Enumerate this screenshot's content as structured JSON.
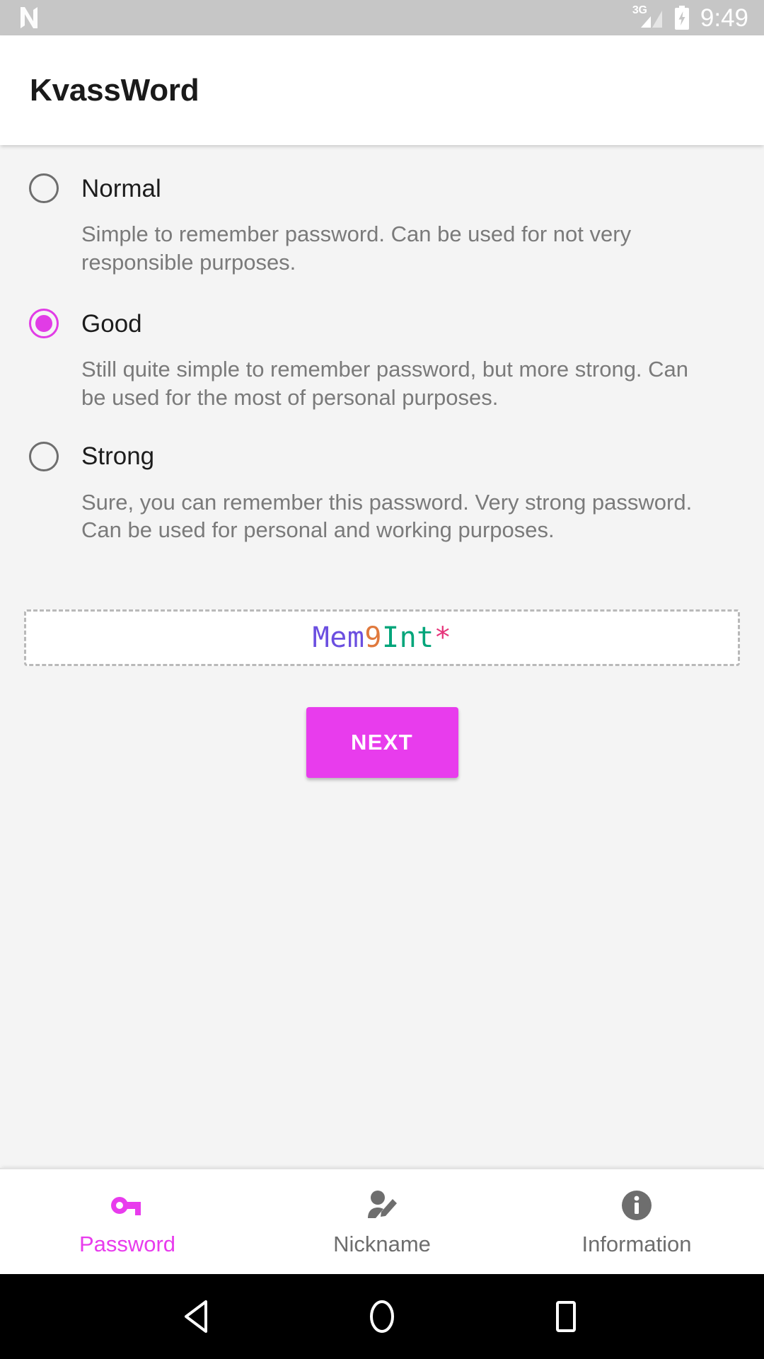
{
  "status_bar": {
    "notification_icon": "android-n-logo-icon",
    "network_type": "3G",
    "signal_icon": "signal-bars-icon",
    "battery_icon": "battery-charging-icon",
    "time": "9:49",
    "background_color": "#C6C6C6",
    "foreground_color": "#FFFFFF"
  },
  "app_bar": {
    "title": "KvassWord",
    "background_color": "#FFFFFF",
    "title_color": "#1A1A1A"
  },
  "theme": {
    "accent_color": "#E83CED",
    "radio_selected_color": "#E13CE6",
    "content_background": "#F4F4F4",
    "secondary_text_color": "#7A7A7A"
  },
  "main": {
    "options": [
      {
        "label": "Normal",
        "description": "Simple to remember password. Can be used for not very responsible purposes.",
        "selected": false
      },
      {
        "label": "Good",
        "description": "Still quite simple to remember password, but more strong. Can be used for the most of personal purposes.",
        "selected": true
      },
      {
        "label": "Strong",
        "description": "Sure, you can remember this password. Very strong password. Can be used for personal and working purposes.",
        "selected": false
      }
    ],
    "password_preview": {
      "value": "Mem9Int*",
      "segments": [
        {
          "text": "Mem",
          "color": "#6B4FE0"
        },
        {
          "text": "9",
          "color": "#E0793D"
        },
        {
          "text": "Int",
          "color": "#00A57A"
        },
        {
          "text": "*",
          "color": "#E6347A"
        }
      ],
      "border_style": "dashed",
      "border_color": "#B9B9B9",
      "background_color": "#FFFFFF"
    },
    "next_button": {
      "label": "NEXT",
      "background_color": "#E83CED",
      "text_color": "#FFFFFF"
    }
  },
  "tab_bar": {
    "tabs": [
      {
        "label": "Password",
        "icon": "key-icon",
        "active": true
      },
      {
        "label": "Nickname",
        "icon": "person-edit-icon",
        "active": false
      },
      {
        "label": "Information",
        "icon": "info-circle-icon",
        "active": false
      }
    ]
  },
  "nav_bar": {
    "buttons": [
      {
        "name": "back-button",
        "icon": "triangle-back-icon"
      },
      {
        "name": "home-button",
        "icon": "circle-home-icon"
      },
      {
        "name": "recents-button",
        "icon": "square-recents-icon"
      }
    ],
    "background_color": "#000000"
  }
}
